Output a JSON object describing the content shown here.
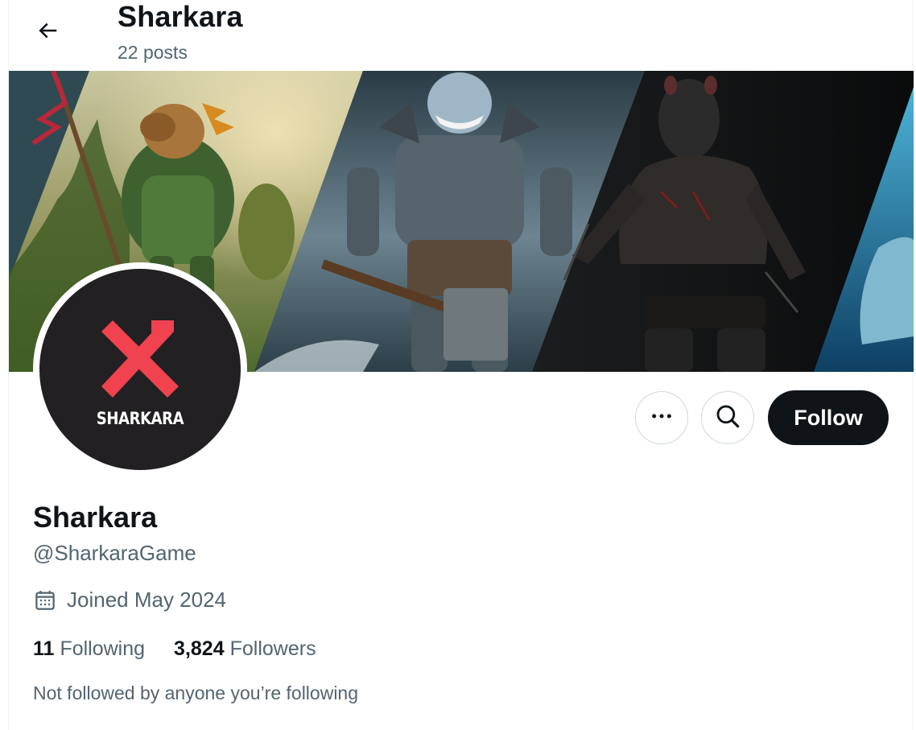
{
  "header": {
    "title": "Sharkara",
    "posts": "22 posts"
  },
  "avatar": {
    "logo_text": "SHARKARA",
    "logo_color": "#f0424f",
    "background": "#222022"
  },
  "actions": {
    "follow_label": "Follow"
  },
  "profile": {
    "name": "Sharkara",
    "handle": "@SharkaraGame",
    "joined": "Joined May 2024",
    "following_count": "11",
    "following_label": "Following",
    "followers_count": "3,824",
    "followers_label": "Followers",
    "not_followed": "Not followed by anyone you’re following"
  },
  "icons": {
    "back": "arrow-left-icon",
    "more": "more-horizontal-icon",
    "search": "search-icon",
    "calendar": "calendar-icon"
  },
  "colors": {
    "text_primary": "#0f1419",
    "text_secondary": "#536471",
    "border": "#cfd9de"
  }
}
